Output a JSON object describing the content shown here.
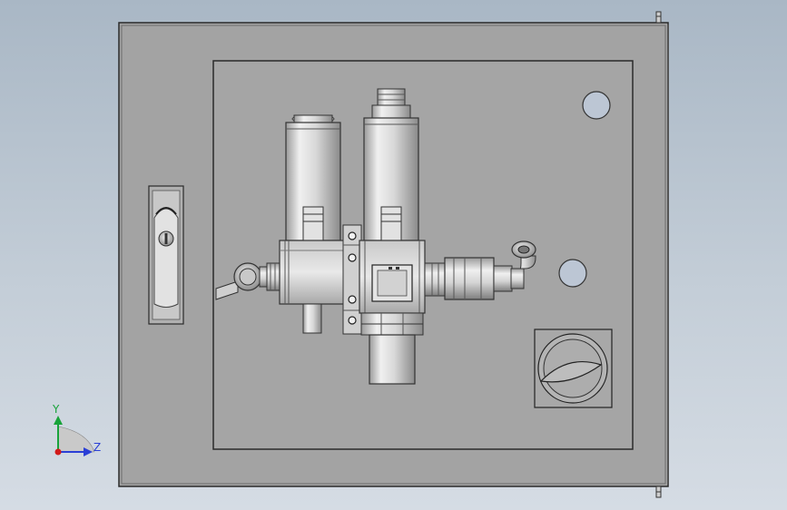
{
  "viewport": {
    "background_top": "#a9b7c5",
    "background_bottom": "#d5dce4"
  },
  "model": {
    "enclosure_color": "#a3a3a3",
    "panel_color": "#a5a5a5",
    "metal_light": "#e6e6e6",
    "metal_dark": "#8e8e8e",
    "hole_color": "#bcc6d4",
    "outline_color": "#2a2a2a"
  },
  "triad": {
    "y_label": "Y",
    "z_label": "Z",
    "y_color": "#18a33a",
    "z_color": "#2a3fd6",
    "x_color": "#d11a1a"
  }
}
